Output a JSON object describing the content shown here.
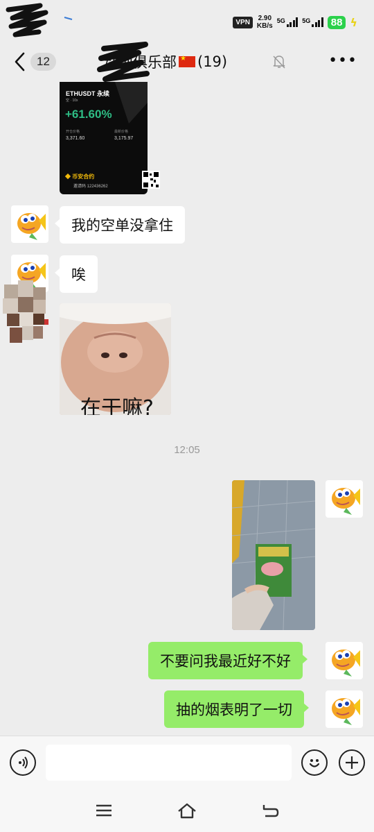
{
  "status_bar": {
    "vpn": "VPN",
    "speed_value": "2.90",
    "speed_unit": "KB/s",
    "network_1": "5G",
    "network_2": "5G",
    "battery": "88"
  },
  "header": {
    "back_count": "12",
    "title": "动创俱乐部",
    "member_count": "(19)"
  },
  "messages": {
    "shared_card": {
      "pair": "ETHUSDT 永续",
      "pair_sub": "空 · 10x",
      "pnl": "+61.60%",
      "entry_label": "开仓价格",
      "entry_price": "3,371.60",
      "last_label": "最新价格",
      "last_price": "3,175.97",
      "brand": "币安合约",
      "referral": "邀请码 122436262"
    },
    "msg_1": "我的空单没拿住",
    "msg_2": "唉",
    "meme_caption": "在干嘛?",
    "timestamp": "12:05",
    "msg_3": "不要问我最近好不好",
    "msg_4": "抽的烟表明了一切"
  },
  "input": {
    "value": "",
    "placeholder": ""
  },
  "colors": {
    "background": "#ededed",
    "outgoing_bubble": "#95ec69",
    "incoming_bubble": "#ffffff",
    "battery": "#2bd14b",
    "profit": "#2ebd85"
  },
  "icons": {
    "voice": "voice-icon",
    "emoji": "emoji-icon",
    "plus": "plus-icon",
    "mute": "mute-bell-icon",
    "more": "more-icon"
  }
}
